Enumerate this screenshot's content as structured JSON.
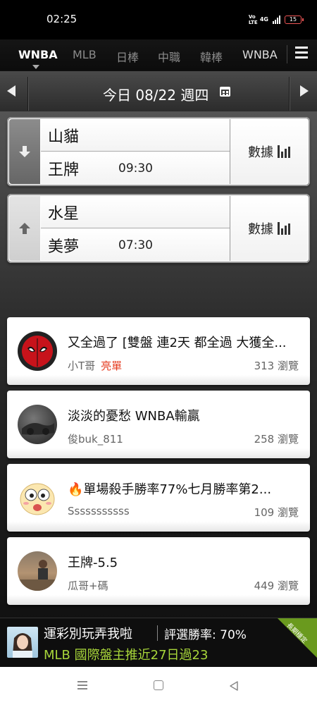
{
  "status": {
    "time": "02:25",
    "volte": "Vo LTE",
    "network": "4G",
    "battery": "15"
  },
  "league_tabs": [
    {
      "label": "WNBA",
      "active": true
    },
    {
      "label": "MLB",
      "active": false
    },
    {
      "label": "日棒",
      "active": false
    },
    {
      "label": "中職",
      "active": false
    },
    {
      "label": "韓棒",
      "active": false
    },
    {
      "label": "WNBA",
      "active": false
    }
  ],
  "date_bar": {
    "date_text": "今日 08/22 週四"
  },
  "games": [
    {
      "away": "山貓",
      "home": "王牌",
      "time": "09:30",
      "stats_label": "數據",
      "arrow": "down"
    },
    {
      "away": "水星",
      "home": "美夢",
      "time": "07:30",
      "stats_label": "數據",
      "arrow": "up"
    }
  ],
  "posts": [
    {
      "title": "又全過了 [雙盤 連2天 都全過 大獲全...",
      "author": "小T哥",
      "badge": "亮單",
      "views": "313 瀏覽"
    },
    {
      "title": "淡淡的憂愁 WNBA輸贏",
      "author": "俊buk_811",
      "badge": "",
      "views": "258 瀏覽"
    },
    {
      "title": "🔥單場殺手勝率77%七月勝率第2...",
      "author": "Sssssssssss",
      "badge": "",
      "views": "109 瀏覽"
    },
    {
      "title": "王牌-5.5",
      "author": "瓜哥+碼",
      "badge": "",
      "views": "449 瀏覽"
    }
  ],
  "ad": {
    "line1": "運彩別玩弄我啦",
    "rate": "評選勝率: 70%",
    "line2": "MLB 國際盤主推近27日過23",
    "corner": "長期穩定"
  }
}
